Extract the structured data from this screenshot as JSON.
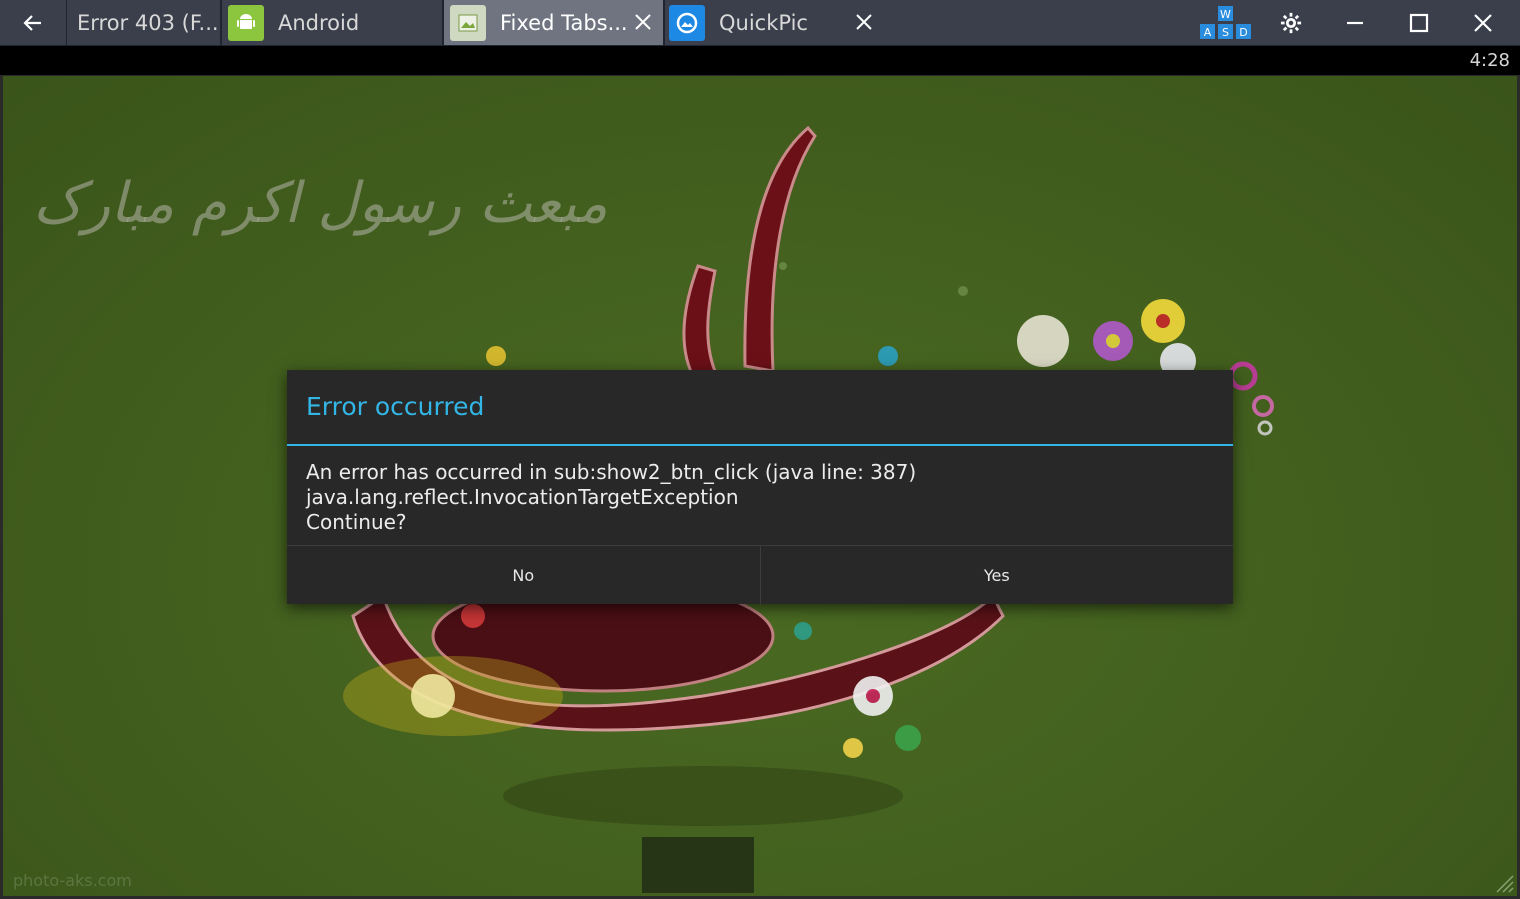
{
  "tabs": [
    {
      "label": "Error 403 (F...",
      "icon": "document-icon",
      "active": false,
      "closable": false
    },
    {
      "label": "Android",
      "icon": "android-icon",
      "active": false,
      "closable": false
    },
    {
      "label": "Fixed Tabs...",
      "icon": "app-icon",
      "active": true,
      "closable": true
    },
    {
      "label": "QuickPic",
      "icon": "quickpic-icon",
      "active": false,
      "closable": true
    }
  ],
  "keymap_badge": {
    "top": "W",
    "bottom": [
      "A",
      "S",
      "D"
    ]
  },
  "status_bar": {
    "time": "4:28"
  },
  "wallpaper": {
    "calligraphy": "مبعث رسول اکرم مبارک",
    "watermark": "photo-aks.com"
  },
  "dialog": {
    "title": "Error occurred",
    "message_lines": [
      "An error has occurred in sub:show2_btn_click (java line: 387)",
      "java.lang.reflect.InvocationTargetException",
      "Continue?"
    ],
    "buttons": {
      "no": "No",
      "yes": "Yes"
    }
  },
  "colors": {
    "accent": "#33b5e5",
    "titlebar": "#3a3f4b",
    "active_tab": "#6f7480",
    "dialog_bg": "#282828",
    "wallpaper_green": "#44611f"
  }
}
